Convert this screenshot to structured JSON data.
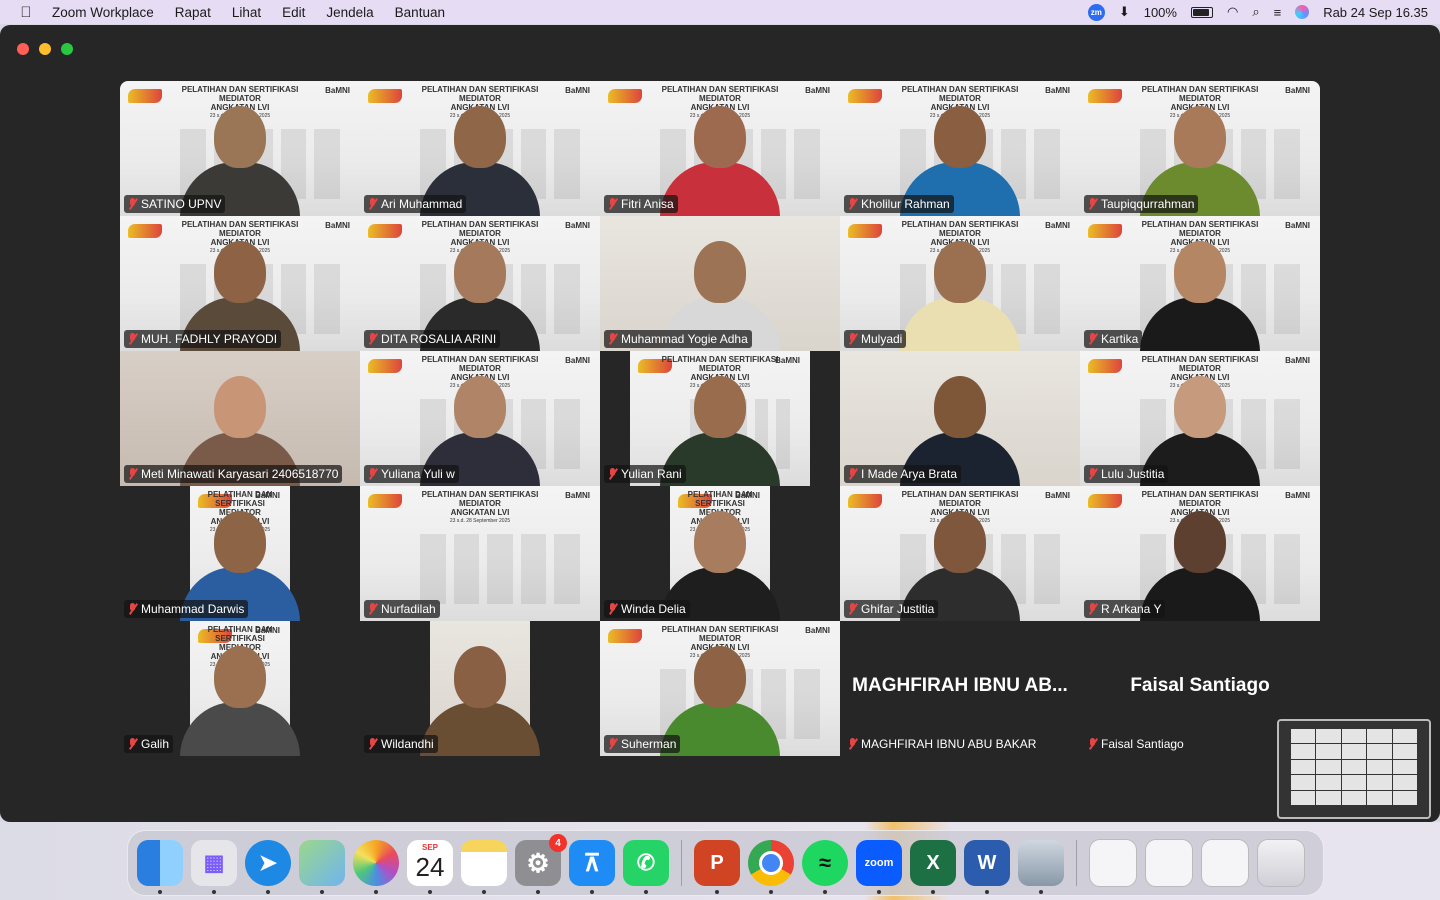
{
  "menubar": {
    "apple": "",
    "app_name": "Zoom Workplace",
    "menus": [
      "Rapat",
      "Lihat",
      "Edit",
      "Jendela",
      "Bantuan"
    ],
    "zoom_badge": "zm",
    "battery": "100%",
    "datetime": "Rab 24 Sep  16.35"
  },
  "banner": {
    "line1": "PELATIHAN DAN SERTIFIKASI",
    "line2": "MEDIATOR",
    "line3": "ANGKATAN LVI",
    "dates": "23 s.d. 28 September 2025",
    "brand": "BaMNI"
  },
  "participants": [
    {
      "name": "SATINO UPNV",
      "bg": "banner",
      "shirt": "#3b3a36",
      "skin": "#9a7556"
    },
    {
      "name": "Ari Muhammad",
      "bg": "banner",
      "shirt": "#2a2f3a",
      "skin": "#8f6648"
    },
    {
      "name": "Fitri Anisa",
      "bg": "banner",
      "shirt": "#c8313c",
      "skin": "#9d6a4f"
    },
    {
      "name": "Kholilur Rahman",
      "bg": "banner",
      "shirt": "#1f6fae",
      "skin": "#8a5e40"
    },
    {
      "name": "Taupiqqurrahman",
      "bg": "banner",
      "shirt": "#6c8a2e",
      "skin": "#a87a5a"
    },
    {
      "name": "MUH. FADHLY PRAYODI",
      "bg": "banner",
      "shirt": "#5a4a3a",
      "skin": "#8d6245"
    },
    {
      "name": "DITA ROSALIA ARINI",
      "bg": "banner",
      "shirt": "#2a2a2a",
      "skin": "#a57a5c"
    },
    {
      "name": "Muhammad Yogie Adha",
      "bg": "room",
      "shirt": "#d8d8d8",
      "skin": "#9c7354"
    },
    {
      "name": "Mulyadi",
      "bg": "banner",
      "shirt": "#e9dfb0",
      "skin": "#9a7050"
    },
    {
      "name": "Kartika",
      "bg": "banner",
      "shirt": "#1a1a1a",
      "skin": "#b48664"
    },
    {
      "name": "Meti Minawati Karyasari 2406518770",
      "bg": "home",
      "shirt": "#7a5a48",
      "skin": "#c99577"
    },
    {
      "name": "Yuliana Yuli w",
      "bg": "banner",
      "shirt": "#2e2e3a",
      "skin": "#b08466"
    },
    {
      "name": "Yulian Rani",
      "bg": "banner-narrow-c",
      "shirt": "#2a3a2a",
      "skin": "#9a6c4e"
    },
    {
      "name": "I Made Arya Brata",
      "bg": "room",
      "shirt": "#1b2230",
      "skin": "#7e5638"
    },
    {
      "name": "Lulu Justitia",
      "bg": "banner",
      "shirt": "#1c1c1c",
      "skin": "#c59a7d"
    },
    {
      "name": "Muhammad Darwis",
      "bg": "banner-narrow",
      "shirt": "#2a5ea0",
      "skin": "#8e6446"
    },
    {
      "name": "Nurfadilah",
      "bg": "banner",
      "shirt": "none",
      "skin": "none"
    },
    {
      "name": "Winda Delia",
      "bg": "banner-narrow",
      "shirt": "#1e1e1e",
      "skin": "#a87c5e"
    },
    {
      "name": "Ghifar Justitia",
      "bg": "banner",
      "shirt": "#2d2d2d",
      "skin": "#7e573c"
    },
    {
      "name": "R Arkana Y",
      "bg": "banner",
      "shirt": "#1a1a1a",
      "skin": "#5e4030"
    },
    {
      "name": "Galih",
      "bg": "banner-narrow",
      "shirt": "#4a4a4a",
      "skin": "#9a7050"
    },
    {
      "name": "Wildandhi",
      "bg": "room-narrow",
      "shirt": "#6a4e34",
      "skin": "#8a6044"
    },
    {
      "name": "Suherman",
      "bg": "banner",
      "shirt": "#4a8a2e",
      "skin": "#8e6244"
    },
    {
      "name": "MAGHFIRAH IBNU ABU BAKAR",
      "bg": "none",
      "display": "MAGHFIRAH IBNU AB...",
      "shirt": "none",
      "skin": "none"
    },
    {
      "name": "Faisal Santiago",
      "bg": "none",
      "display": "Faisal Santiago",
      "shirt": "none",
      "skin": "none"
    }
  ],
  "dock": {
    "apps": [
      {
        "name": "Finder",
        "icon": "finder-icon",
        "color": "#3a8ee6"
      },
      {
        "name": "Launchpad",
        "icon": "launchpad-icon",
        "color": "#e5e5ea"
      },
      {
        "name": "Safari",
        "icon": "safari-icon",
        "color": "#1e88e5"
      },
      {
        "name": "Maps",
        "icon": "maps-icon",
        "color": "#5fbf6a"
      },
      {
        "name": "Photos",
        "icon": "photos-icon",
        "color": "#ffffff"
      },
      {
        "name": "Calendar",
        "icon": "calendar-icon",
        "color": "#ffffff"
      },
      {
        "name": "Notes",
        "icon": "notes-icon",
        "color": "#f7d55c"
      },
      {
        "name": "System Settings",
        "icon": "settings-icon",
        "color": "#8e8e93"
      },
      {
        "name": "App Store",
        "icon": "appstore-icon",
        "color": "#1f8cf5"
      },
      {
        "name": "WhatsApp",
        "icon": "whatsapp-icon",
        "color": "#25d366"
      },
      {
        "name": "PowerPoint",
        "icon": "powerpoint-icon",
        "color": "#d04423"
      },
      {
        "name": "Chrome",
        "icon": "chrome-icon",
        "color": "#ffffff"
      },
      {
        "name": "Spotify",
        "icon": "spotify-icon",
        "color": "#111111"
      },
      {
        "name": "Zoom",
        "icon": "zoom-icon",
        "color": "#0b5cff"
      },
      {
        "name": "Excel",
        "icon": "excel-icon",
        "color": "#1d7044"
      },
      {
        "name": "Word",
        "icon": "word-icon",
        "color": "#2b5cad"
      },
      {
        "name": "Preview",
        "icon": "preview-icon",
        "color": "#a8b8c8"
      }
    ],
    "calendar_month": "SEP",
    "calendar_day": "24",
    "settings_badge": "4",
    "zoom_label": "zoom",
    "ppt_label": "P",
    "excel_label": "X",
    "word_label": "W"
  }
}
